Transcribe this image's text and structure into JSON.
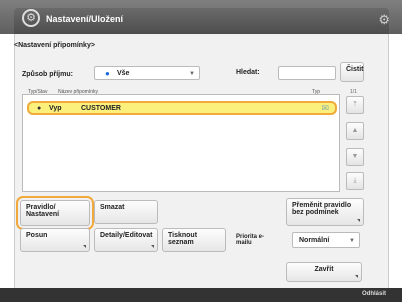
{
  "header": {
    "title": "Nastavení/Uložení"
  },
  "breadcrumb": "<Nastavení připomínky>",
  "filter": {
    "type_label": "Způsob příjmu:",
    "type_value": "Vše",
    "search_label": "Hledat:",
    "search_value": "",
    "clear_label": "Čistit"
  },
  "list": {
    "col1": "Typ/Stav",
    "col2": "Název připomínky",
    "col3": "Typ",
    "page": "1/1",
    "rows": [
      {
        "type": "Vyp",
        "name": "CUSTOMER"
      }
    ]
  },
  "buttons": {
    "rules_setup": "Pravidlo/ Nastavení",
    "delete": "Smazat",
    "rules_conditions": "Přeměnit pravidlo bez podmínek",
    "shift": "Posun",
    "details_edit": "Detaily/Editovat",
    "fax_priority": "Tisknout seznam",
    "priority_label": "Priorita e-mailu",
    "priority_value": "Normální",
    "close": "Zavřít"
  },
  "status": {
    "text": "Odhlásit"
  }
}
